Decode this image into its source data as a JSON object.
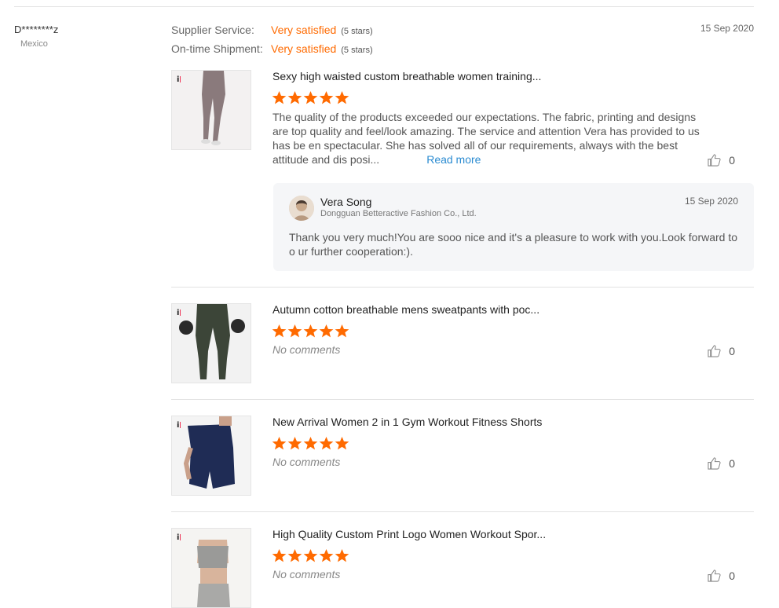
{
  "review": {
    "buyer_name": "D********z",
    "buyer_country": "Mexico",
    "date": "15 Sep 2020",
    "supplier_service": {
      "label": "Supplier Service:",
      "value": "Very satisfied",
      "stars_note": "(5 stars)"
    },
    "ontime_shipment": {
      "label": "On-time Shipment:",
      "value": "Very satisfied",
      "stars_note": "(5 stars)"
    }
  },
  "colors": {
    "accent": "#ff6a00",
    "link": "#2a8bd1",
    "reply_bg": "#f5f6f8"
  },
  "products": [
    {
      "title": "Sexy high waisted custom breathable women training...",
      "rating": 5,
      "comment": "The quality of the products exceeded our expectations. The fabric, printing and designs are top quality and feel/look amazing. The service and attention Vera has provided to us has be en spectacular. She has solved all of our requirements, always with the best attitude and dis posi...",
      "read_more": "Read more",
      "likes": "0",
      "icon": "thumbs-up-icon"
    },
    {
      "title": "Autumn cotton breathable mens sweatpants with poc...",
      "rating": 5,
      "comment": "No comments",
      "likes": "0",
      "icon": "thumbs-up-icon"
    },
    {
      "title": "New Arrival Women 2 in 1 Gym Workout Fitness Shorts",
      "rating": 5,
      "comment": "No comments",
      "likes": "0",
      "icon": "thumbs-up-icon"
    },
    {
      "title": "High Quality Custom Print Logo Women Workout Spor...",
      "rating": 5,
      "comment": "No comments",
      "likes": "0",
      "icon": "thumbs-up-icon"
    }
  ],
  "reply": {
    "name": "Vera Song",
    "company": "Dongguan Betteractive Fashion Co., Ltd.",
    "date": "15 Sep 2020",
    "text": "Thank you very much!You are sooo nice and it's a pleasure to work with you.Look forward to o ur further cooperation:)."
  }
}
